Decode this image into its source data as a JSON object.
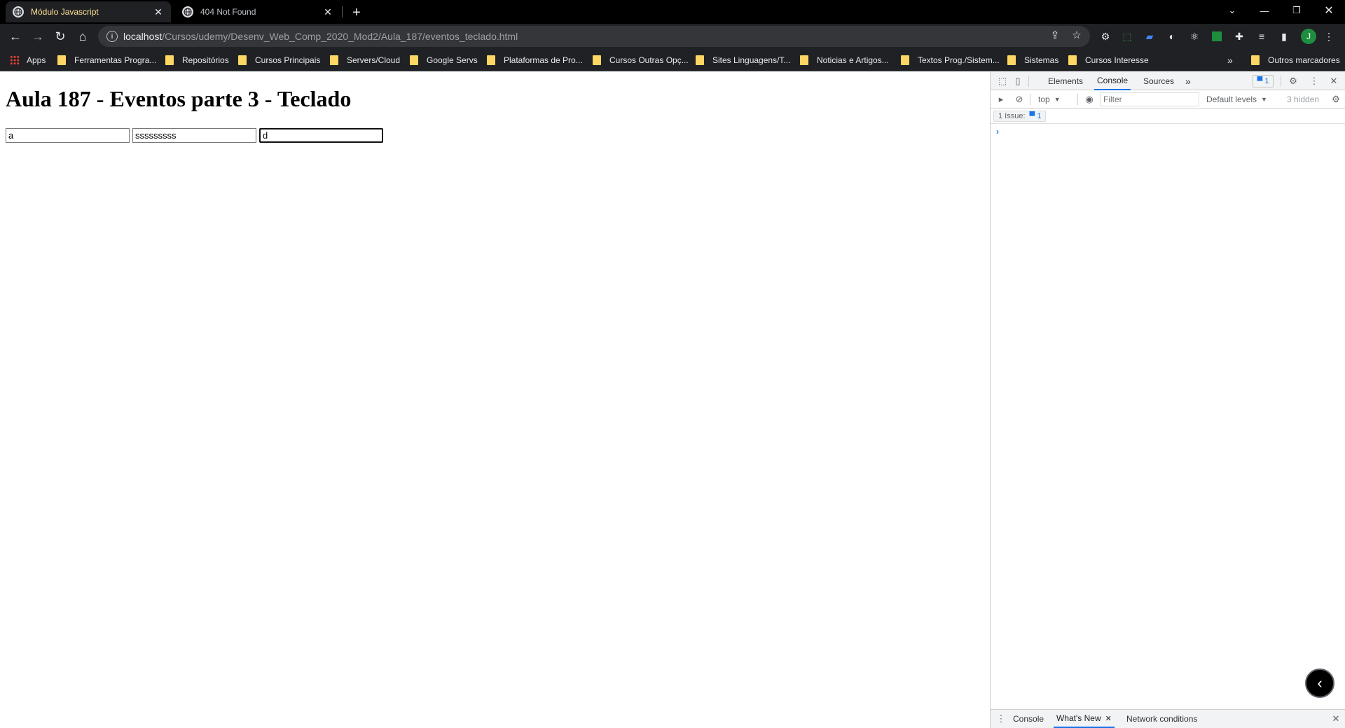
{
  "browser": {
    "tabs": [
      {
        "title": "Módulo Javascript",
        "active": true
      },
      {
        "title": "404 Not Found",
        "active": false
      }
    ],
    "url": {
      "host": "localhost",
      "path": "/Cursos/udemy/Desenv_Web_Comp_2020_Mod2/Aula_187/eventos_teclado.html"
    },
    "profile_initial": "J",
    "bookmarks": [
      "Apps",
      "Ferramentas Progra...",
      "Repositórios",
      "Cursos Principais",
      "Servers/Cloud",
      "Google Servs",
      "Plataformas de Pro...",
      "Cursos Outras Opç...",
      "Sites Linguagens/T...",
      "Noticias e Artigos...",
      "Textos Prog./Sistem...",
      "Sistemas",
      "Cursos Interesse"
    ],
    "bookmarks_overflow": "»",
    "other_bookmarks": "Outros marcadores"
  },
  "page": {
    "heading": "Aula 187 - Eventos parte 3 - Teclado",
    "inputs": [
      {
        "value": "a",
        "focused": false
      },
      {
        "value": "sssssssss",
        "focused": false
      },
      {
        "value": "d",
        "focused": true
      }
    ]
  },
  "devtools": {
    "tabs": [
      "Elements",
      "Console",
      "Sources"
    ],
    "active_tab": "Console",
    "more_tabs": "»",
    "issue_badge_count": "1",
    "context": "top",
    "filter_placeholder": "Filter",
    "levels": "Default levels",
    "hidden": "3 hidden",
    "issues_label": "1 Issue:",
    "issues_count": "1",
    "prompt": "›",
    "drawer_tabs": [
      "Console",
      "What's New",
      "Network conditions"
    ],
    "drawer_active": "What's New"
  },
  "colors": {
    "tab_active_text": "#fde293",
    "accent": "#1a73e8",
    "folder": "#fdd663"
  }
}
